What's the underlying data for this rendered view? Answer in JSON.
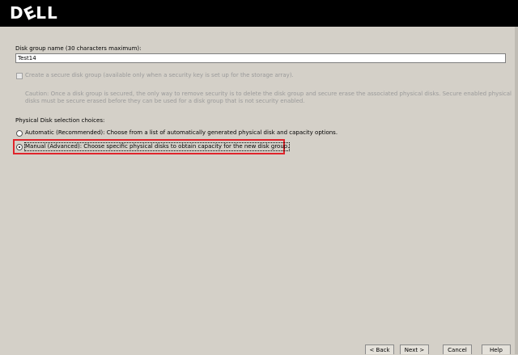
{
  "header": {
    "logo_text_d": "D",
    "logo_text_e": "E",
    "logo_text_ll": "LL"
  },
  "form": {
    "name_label": "Disk group name (30 characters maximum):",
    "name_value": "Test14",
    "secure_label": "Create a secure disk group (available only when a security key is set up for the storage array).",
    "caution_line1": "Caution: Once a disk group is secured, the only way to remove security is to delete the disk group and secure erase the associated physical disks. Secure enabled physical",
    "caution_line2": "disks must be secure erased before they can be used for a disk group that is not security enabled.",
    "selection_heading": "Physical Disk selection choices:",
    "automatic_label": "Automatic (Recommended): Choose from a list of automatically generated physical disk and capacity options.",
    "manual_label": "Manual (Advanced): Choose specific physical disks to obtain capacity for the new disk group."
  },
  "buttons": {
    "back": "< Back",
    "next": "Next >",
    "cancel": "Cancel",
    "help": "Help"
  },
  "colors": {
    "highlight": "#e0242b",
    "background": "#d4d0c8",
    "header": "#000000"
  }
}
